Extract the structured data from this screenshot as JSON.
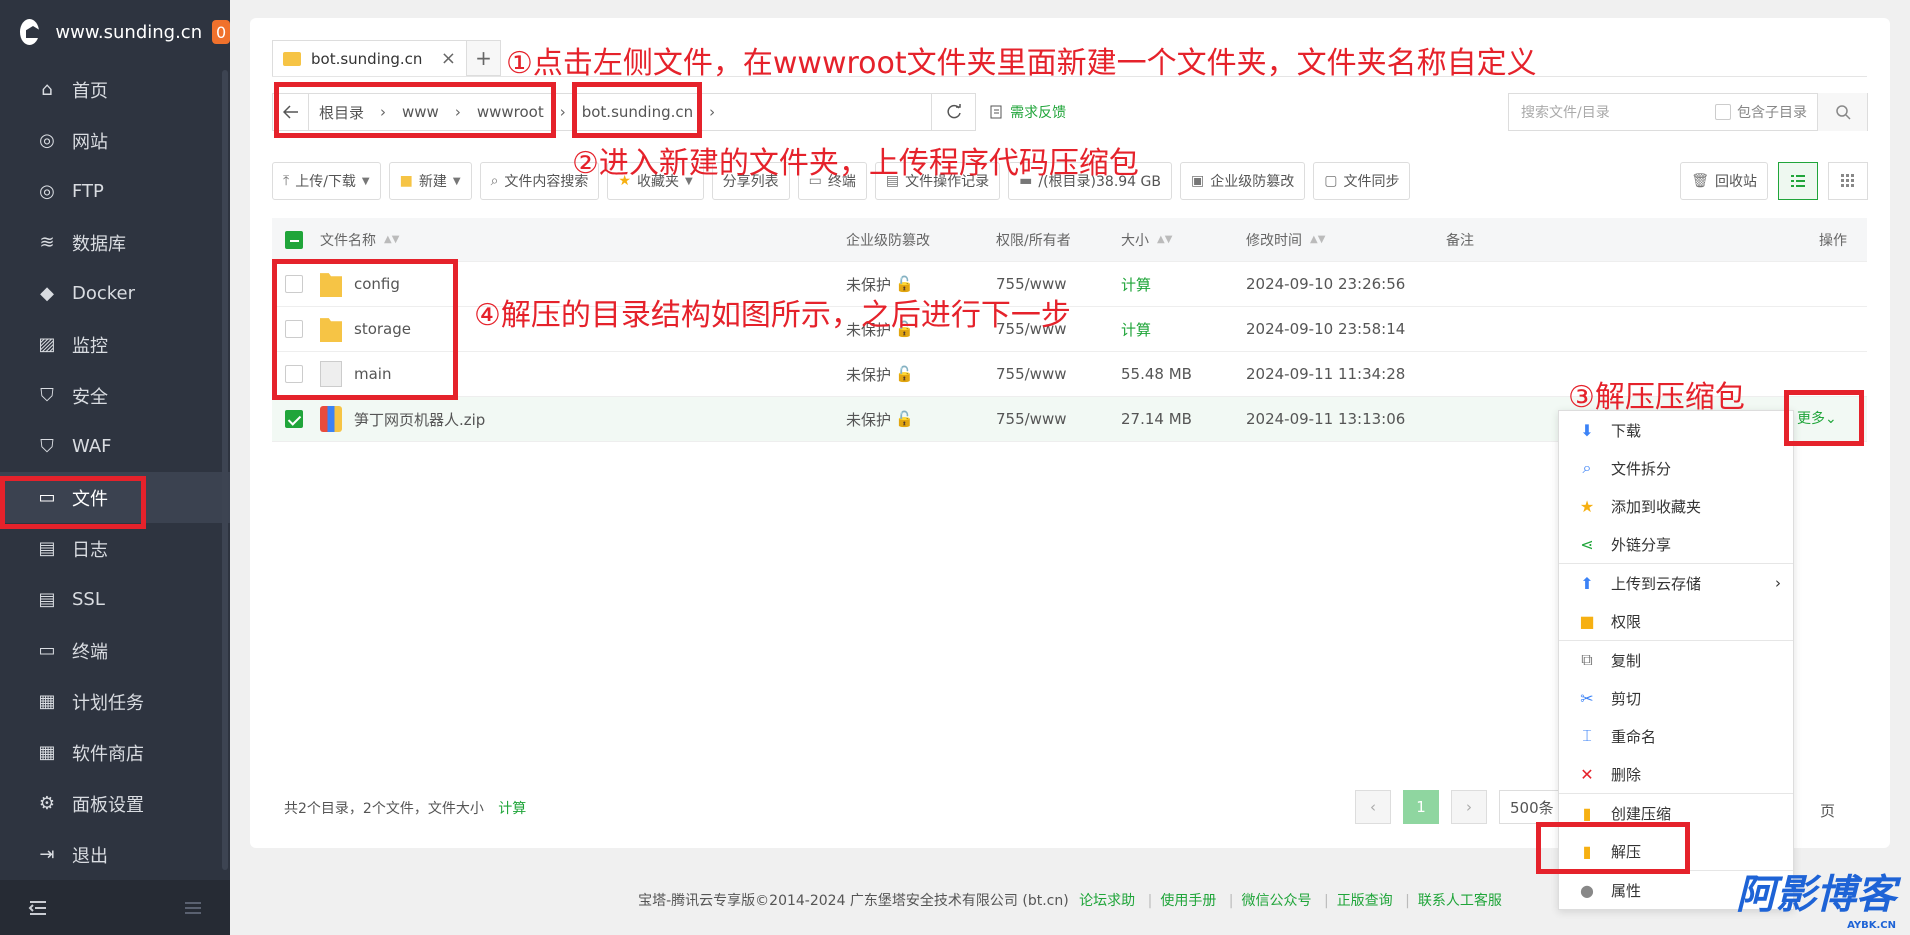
{
  "sidebar": {
    "site": "www.sunding.cn",
    "badge": "0",
    "items": [
      {
        "label": "首页",
        "icon": "home-icon"
      },
      {
        "label": "网站",
        "icon": "globe-icon"
      },
      {
        "label": "FTP",
        "icon": "ftp-icon"
      },
      {
        "label": "数据库",
        "icon": "database-icon"
      },
      {
        "label": "Docker",
        "icon": "docker-icon"
      },
      {
        "label": "监控",
        "icon": "monitor-icon"
      },
      {
        "label": "安全",
        "icon": "shield-icon"
      },
      {
        "label": "WAF",
        "icon": "waf-icon"
      },
      {
        "label": "文件",
        "icon": "folder-icon"
      },
      {
        "label": "日志",
        "icon": "log-icon"
      },
      {
        "label": "SSL",
        "icon": "ssl-icon"
      },
      {
        "label": "终端",
        "icon": "terminal-icon"
      },
      {
        "label": "计划任务",
        "icon": "calendar-icon"
      },
      {
        "label": "软件商店",
        "icon": "apps-icon"
      },
      {
        "label": "面板设置",
        "icon": "gear-icon"
      },
      {
        "label": "退出",
        "icon": "logout-icon"
      }
    ]
  },
  "tab": {
    "label": "bot.sunding.cn",
    "add": "+",
    "close": "×"
  },
  "path": {
    "crumbs": [
      "根目录",
      "www",
      "wwwroot",
      "bot.sunding.cn"
    ],
    "feedback": "需求反馈"
  },
  "search": {
    "placeholder": "搜索文件/目录",
    "include_sub": "包含子目录"
  },
  "toolbar": {
    "upload": "上传/下载",
    "new": "新建",
    "content_search": "文件内容搜索",
    "favorites": "收藏夹",
    "share_list": "分享列表",
    "terminal": "终端",
    "op_log": "文件操作记录",
    "disk": "/(根目录)38.94 GB",
    "tamper": "企业级防篡改",
    "sync": "文件同步",
    "recycle": "回收站"
  },
  "table": {
    "headers": {
      "name": "文件名称",
      "tamper": "企业级防篡改",
      "perm": "权限/所有者",
      "size": "大小",
      "mtime": "修改时间",
      "note": "备注",
      "op": "操作"
    },
    "rows": [
      {
        "name": "config",
        "protect": "未保护",
        "perm": "755/www",
        "size": "计算",
        "mtime": "2024-09-10 23:26:56"
      },
      {
        "name": "storage",
        "protect": "未保护",
        "perm": "755/www",
        "size": "计算",
        "mtime": "2024-09-10 23:58:14"
      },
      {
        "name": "main",
        "protect": "未保护",
        "perm": "755/www",
        "size": "55.48 MB",
        "mtime": "2024-09-11 11:34:28"
      },
      {
        "name": "笋丁网页机器人.zip",
        "protect": "未保护",
        "perm": "755/www",
        "size": "27.14 MB",
        "mtime": "2024-09-11 13:13:06"
      }
    ],
    "more": "更多"
  },
  "footer": {
    "summary": "共2个目录，2个文件，文件大小",
    "calc": "计算",
    "page": "1",
    "page_size": "500条",
    "unit": "页"
  },
  "menu": {
    "download": "下载",
    "split": "文件拆分",
    "add_fav": "添加到收藏夹",
    "share": "外链分享",
    "upload_cloud": "上传到云存储",
    "perm": "权限",
    "copy": "复制",
    "cut": "剪切",
    "rename": "重命名",
    "delete": "删除",
    "compress": "创建压缩",
    "extract": "解压",
    "props": "属性"
  },
  "copyright": {
    "text": "宝塔-腾讯云专享版©2014-2024 广东堡塔安全技术有限公司 (bt.cn)",
    "links": [
      "论坛求助",
      "使用手册",
      "微信公众号",
      "正版查询",
      "联系人工客服"
    ]
  },
  "annotations": {
    "a1": "①点击左侧文件，在wwwroot文件夹里面新建一个文件夹，文件夹名称自定义",
    "a2": "②进入新建的文件夹，上传程序代码压缩包",
    "a3": "③解压压缩包",
    "a4": "④解压的目录结构如图所示，之后进行下一步"
  },
  "watermark": {
    "main": "阿影博客",
    "sub": "AYBK.CN"
  },
  "colors": {
    "accent": "#20a53a",
    "annotation": "#e5222b",
    "sidebar": "#2e3440"
  }
}
